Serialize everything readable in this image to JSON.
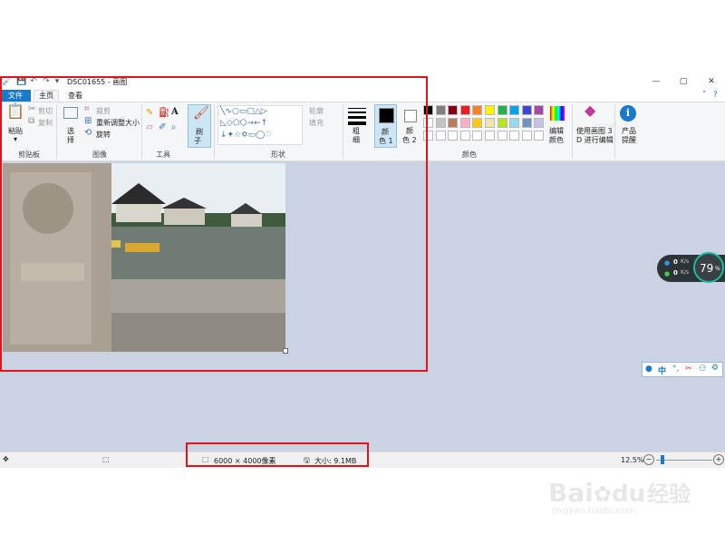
{
  "window": {
    "title": "DSC01655 - 画图",
    "controls": {
      "minimize": "—",
      "maximize": "▢",
      "close": "✕"
    }
  },
  "tabs": [
    {
      "label": "文件"
    },
    {
      "label": "主页"
    },
    {
      "label": "查看"
    }
  ],
  "ribbon": {
    "clipboard": {
      "paste": "粘贴",
      "cut": "剪切",
      "copy": "复制",
      "group": "剪贴板"
    },
    "image": {
      "select": "选",
      "select2": "择",
      "crop": "裁剪",
      "resize": "重新调整大小",
      "rotate": "旋转",
      "group": "图像"
    },
    "tools": {
      "group": "工具"
    },
    "brushes": {
      "label1": "刷",
      "label2": "子"
    },
    "shapes": {
      "outline": "轮廓",
      "fill": "填充",
      "group": "形状"
    },
    "size": {
      "label1": "粗",
      "label2": "细"
    },
    "color1": {
      "label1": "颜",
      "label2": "色 1"
    },
    "color2": {
      "label1": "颜",
      "label2": "色 2"
    },
    "colors_group": "颜色",
    "edit_colors": {
      "label1": "编辑",
      "label2": "颜色"
    },
    "paint3d": {
      "label1": "使用画图 3",
      "label2": "D 进行编辑"
    },
    "product_alert": {
      "label1": "产品",
      "label2": "提醒"
    },
    "palette_row1": [
      "#000000",
      "#7f7f7f",
      "#880015",
      "#ed1c24",
      "#ff7f27",
      "#fff200",
      "#22b14c",
      "#00a2e8",
      "#3f48cc",
      "#a349a4"
    ],
    "palette_row2": [
      "#ffffff",
      "#c3c3c3",
      "#b97a57",
      "#ffaec9",
      "#ffc90e",
      "#efe4b0",
      "#b5e61d",
      "#99d9ea",
      "#7092be",
      "#c8bfe7"
    ]
  },
  "statusbar": {
    "dimensions": "6000 × 4000像素",
    "size": "大小: 9.1MB",
    "zoom": "12.5%"
  },
  "widget": {
    "percent": "79",
    "percent_sign": "%",
    "upload": "0",
    "upload_unit": "K/s",
    "download": "0",
    "download_unit": "K/s"
  },
  "ime": {
    "lang": "中"
  },
  "watermark": {
    "brand": "Bai",
    "brand2": "du",
    "brand_cn": "经验",
    "url": "jingyan.baidu.com"
  },
  "colors": {
    "accent": "#1979ca",
    "highlight": "#e0141a",
    "canvas_bg": "#c9d3e2"
  }
}
